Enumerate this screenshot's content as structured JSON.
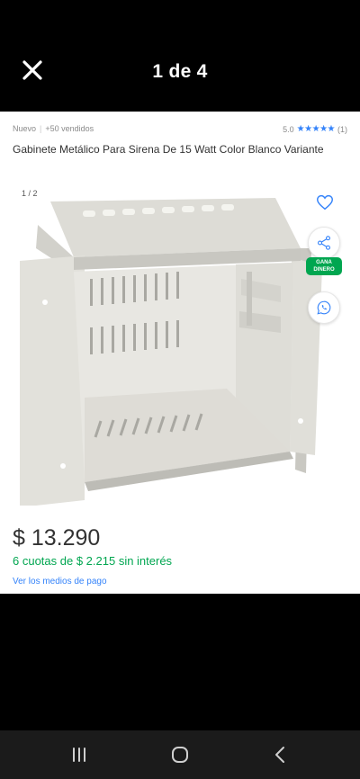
{
  "viewer": {
    "title": "1 de 4"
  },
  "product": {
    "condition": "Nuevo",
    "separator": "|",
    "sold": "+50 vendidos",
    "rating": "5.0",
    "stars": "★★★★★",
    "reviews": "(1)",
    "title": "Gabinete Metálico Para Sirena De 15 Watt Color Blanco Variante"
  },
  "gallery": {
    "counter": "1 / 2",
    "badge_text": "GANA DINERO"
  },
  "pricing": {
    "price": "$ 13.290",
    "installments": "6 cuotas de $ 2.215 sin interés",
    "payment_link": "Ver los medios de pago"
  },
  "colors": {
    "accent_blue": "#3483fa",
    "green": "#00a650",
    "background": "#000000"
  },
  "icons": {
    "close": "close-icon",
    "favorite": "heart-icon",
    "share": "share-icon",
    "whatsapp": "whatsapp-icon",
    "nav_recents": "recents-icon",
    "nav_home": "home-icon",
    "nav_back": "back-icon"
  }
}
